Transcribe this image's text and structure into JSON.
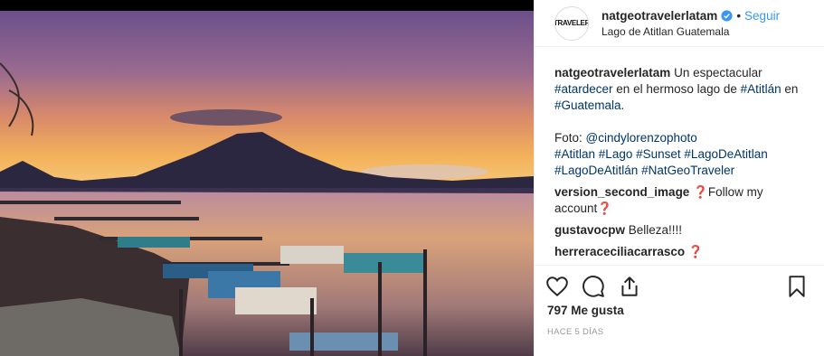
{
  "post": {
    "username": "natgeotravelerlatam",
    "follow_label": "Seguir",
    "separator": "•",
    "location": "Lago de Atitlan Guatemala",
    "avatar_text": "TRAVELER",
    "caption": {
      "username": "natgeotravelerlatam",
      "text_1": " Un espectacular ",
      "tag_1": "#atardecer",
      "text_2": " en el hermoso lago de ",
      "tag_2": "#Atitlán",
      "text_3": " en ",
      "tag_3": "#Guatemala",
      "text_4": ".",
      "foto_label": "Foto: ",
      "mention": "@cindylorenzophoto",
      "tags_line": [
        "#Atitlan",
        "#Lago",
        "#Sunset",
        "#LagoDeAtitlan",
        "#LagoDeAtitlán",
        "#NatGeoTraveler"
      ]
    },
    "comments": [
      {
        "user": "version_second_image",
        "text": " ❓Follow my account❓"
      },
      {
        "user": "gustavocpw",
        "text": " Belleza!!!!"
      },
      {
        "user": "herreraceciliacarrasco",
        "text": " ❓"
      }
    ],
    "likes": "797 Me gusta",
    "time": "HACE 5 DÍAS",
    "icons": [
      "heart-icon",
      "comment-icon",
      "share-icon",
      "bookmark-icon",
      "verified-badge-icon"
    ]
  }
}
